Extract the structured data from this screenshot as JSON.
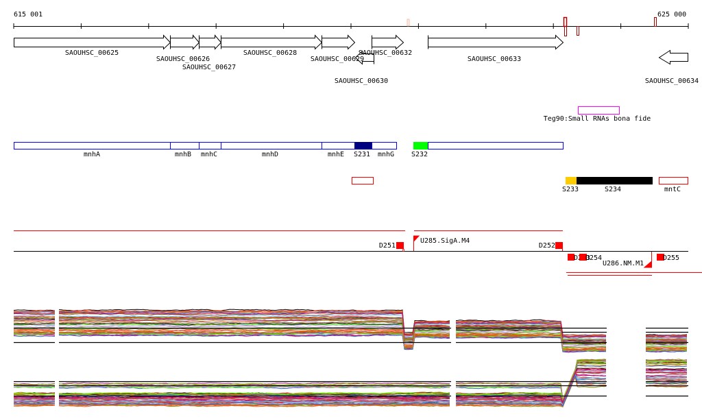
{
  "ruler": {
    "start_label": "615 001",
    "end_label": "625 000"
  },
  "genes": [
    {
      "label": "SAOUHSC_00625"
    },
    {
      "label": "SAOUHSC_00626"
    },
    {
      "label": "SAOUHSC_00627"
    },
    {
      "label": "SAOUHSC_00628"
    },
    {
      "label": "SAOUHSC_00629"
    },
    {
      "label": "SAOUHSC_00632"
    },
    {
      "label": "SAOUHSC_00633"
    },
    {
      "label": "SAOUHSC_00630"
    },
    {
      "label": "SAOUHSC_00634"
    }
  ],
  "srna": {
    "label": "Teg90:Small RNAs bona fide",
    "color": "#ff00ff"
  },
  "segments": [
    {
      "label": "mnhA"
    },
    {
      "label": "mnhB"
    },
    {
      "label": "mnhC"
    },
    {
      "label": "mnhD"
    },
    {
      "label": "mnhE"
    },
    {
      "label": "S231"
    },
    {
      "label": "mnhG"
    },
    {
      "label": "S232"
    }
  ],
  "segments2": [
    {
      "label": "S233"
    },
    {
      "label": "S234"
    },
    {
      "label": "mntC"
    }
  ],
  "promoters": [
    {
      "label": "D251"
    },
    {
      "label": "U285.SigA.M4"
    },
    {
      "label": "D252"
    },
    {
      "label": "D253"
    },
    {
      "label": "D254"
    },
    {
      "label": "U286.NM.M1"
    },
    {
      "label": "D255"
    }
  ],
  "colors": {
    "segment_outline": "#0000ff",
    "S231": "#000080",
    "S232": "#00ff00",
    "S233": "#ffcc00",
    "S234": "#000000",
    "feature_red": "#ff0000",
    "marker_dark_red": "#aa0000"
  },
  "series_palette": [
    "#000000",
    "#66bbff",
    "#bb99cc",
    "#aa2288",
    "#cc3333",
    "#88aa00",
    "#ee6622",
    "#66ff00",
    "#996633",
    "#cc0066",
    "#3366cc",
    "#aa8866",
    "#ff3333",
    "#888800",
    "#cc6600",
    "#777777"
  ]
}
